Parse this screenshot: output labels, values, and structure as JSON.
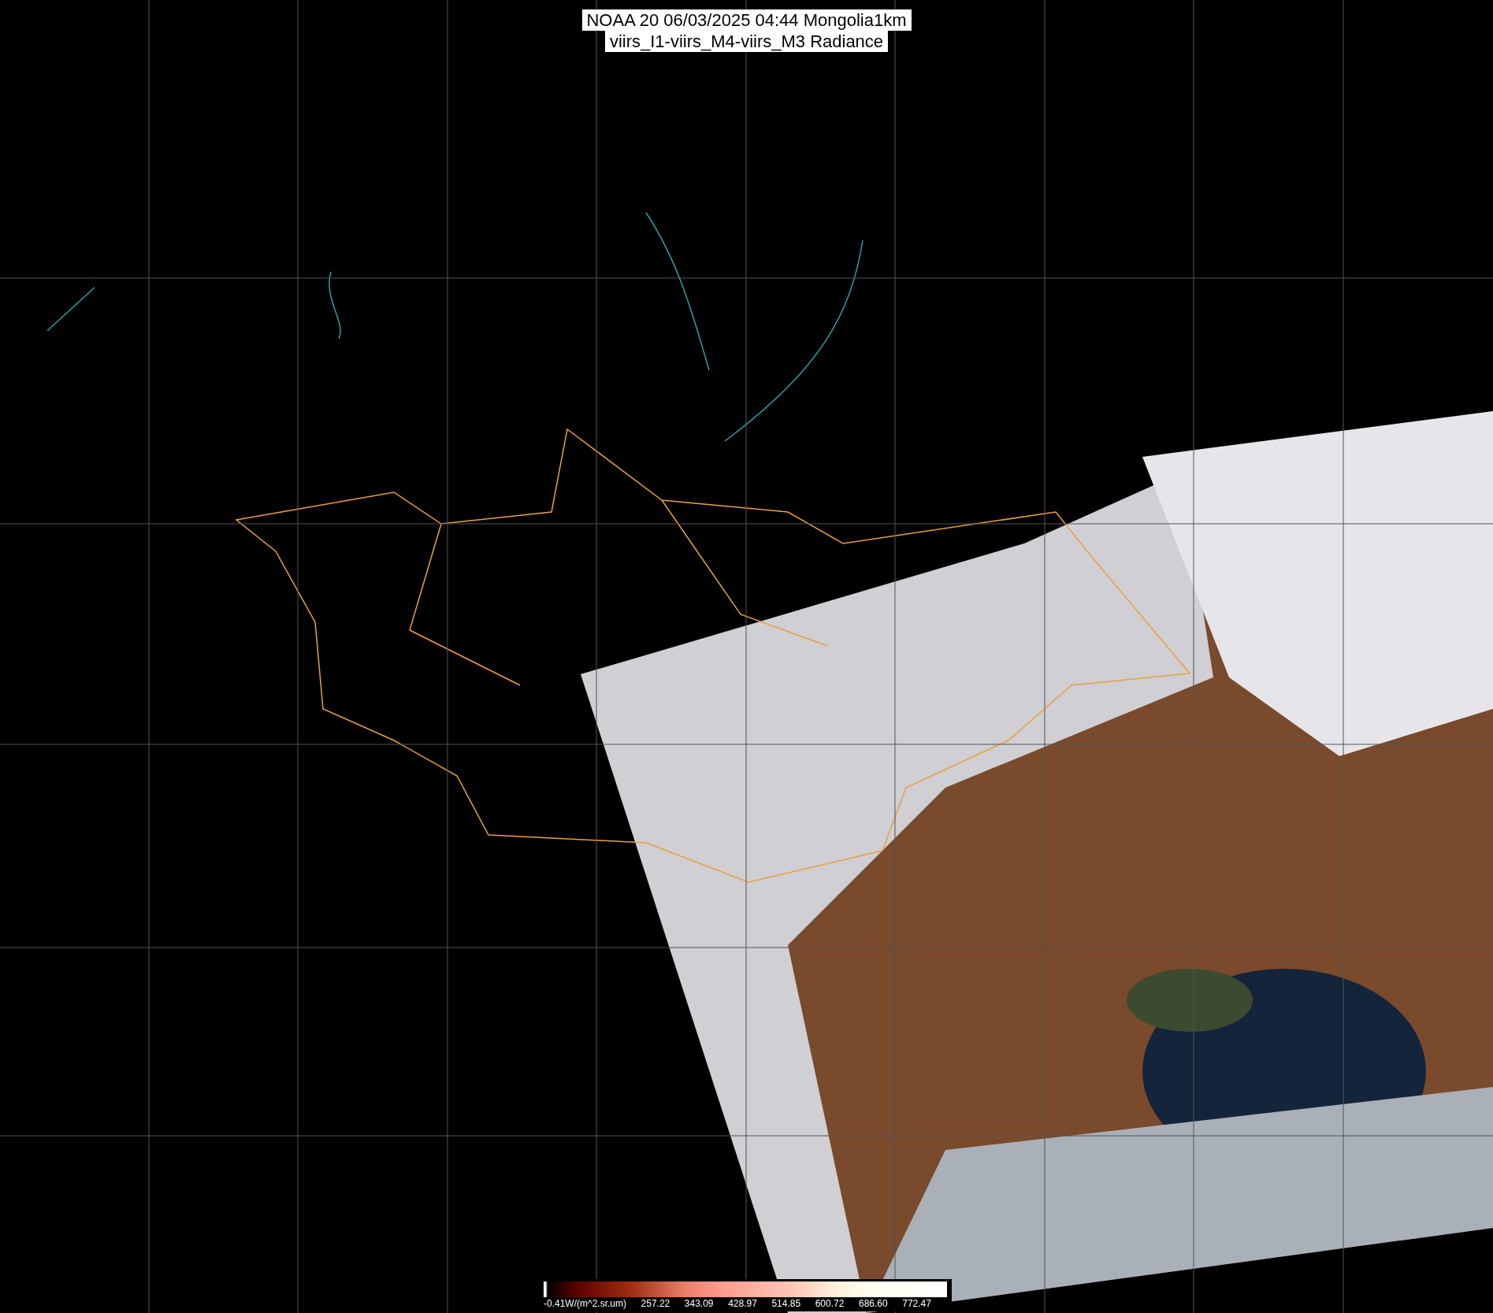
{
  "title": {
    "lines": [
      "NOAA 20 06/03/2025 04:44 Mongolia1km",
      "viirs_I1-viirs_M4-viirs_M3 Radiance"
    ]
  },
  "colorbar": {
    "labels": [
      "-0.41W/(m^2.sr.um)",
      "257.22",
      "343.09",
      "428.97",
      "514.85",
      "600.72",
      "686.60",
      "772.47"
    ]
  }
}
